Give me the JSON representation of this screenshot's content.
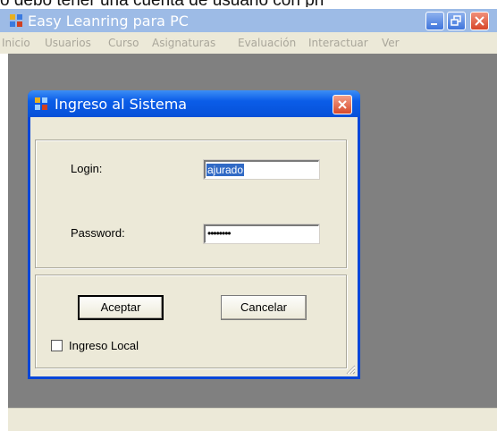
{
  "top_caption": "o debo tener una cuenta de usuario con pri",
  "main_window": {
    "title": "Easy Leanring para PC",
    "menu": [
      "Inicio",
      "Usuarios",
      "Curso",
      "Asignaturas",
      "Evaluación",
      "Interactuar",
      "Ver"
    ]
  },
  "dialog": {
    "title": "Ingreso al Sistema",
    "login_label": "Login:",
    "login_value": "ajurado",
    "password_label": "Password:",
    "password_value": "••••••••",
    "ok_label": "Aceptar",
    "cancel_label": "Cancelar",
    "checkbox_label": "Ingreso Local",
    "checkbox_checked": false
  },
  "colors": {
    "titlebar_inactive": "#9dbbe6",
    "dialog_titlebar": "#0b5de8",
    "mdi_background": "#808080",
    "control_face": "#ece9d8",
    "selection": "#316ac5"
  },
  "icons": [
    "app-icon",
    "minimize-icon",
    "restore-icon",
    "close-icon",
    "dialog-app-icon",
    "dialog-close-icon",
    "resize-grip-icon"
  ]
}
